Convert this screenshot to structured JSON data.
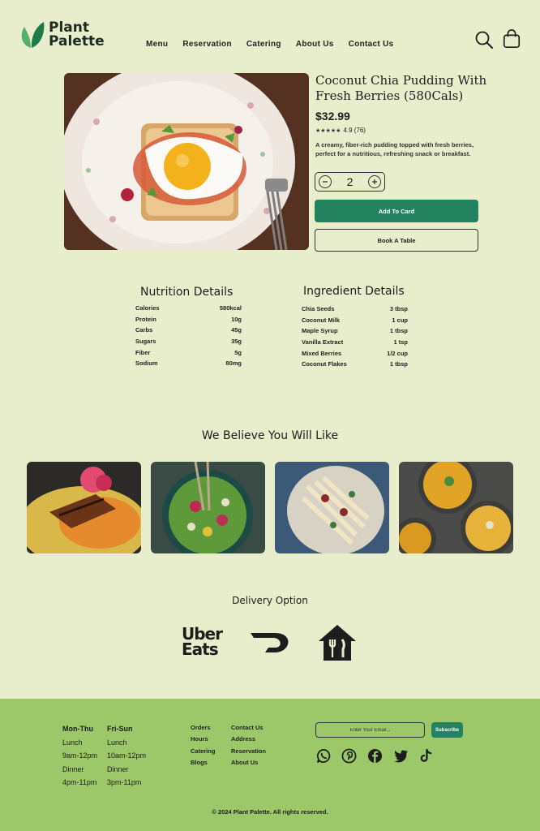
{
  "brand": {
    "line1": "Plant",
    "line2": "Palette",
    "accent": "#23825f",
    "leaf_dark": "#1f7a4a",
    "leaf_light": "#56b06a"
  },
  "nav": {
    "items": [
      "Menu",
      "Reservation",
      "Catering",
      "About Us",
      "Contact Us"
    ]
  },
  "header_icons": [
    "search-icon",
    "shopping-bag-icon"
  ],
  "product": {
    "title": "Coconut Chia Pudding With Fresh Berries (580Cals)",
    "price": "$32.99",
    "stars": "★★★★★",
    "rating": "4.9 (76)",
    "description": "A creamy, fiber-rich pudding topped with fresh berries, perfect for a nutritious, refreshing snack or breakfast.",
    "quantity": "2",
    "add_button": "Add To Card",
    "book_button": "Book A Table"
  },
  "nutrition": {
    "title": "Nutrition Details",
    "rows": [
      [
        "Calories",
        "580kcal"
      ],
      [
        "Protein",
        "10g"
      ],
      [
        "Carbs",
        "45g"
      ],
      [
        "Sugars",
        "35g"
      ],
      [
        "Fiber",
        "5g"
      ],
      [
        "Sodium",
        "80mg"
      ]
    ]
  },
  "ingredients": {
    "title": "Ingredient Details",
    "rows": [
      [
        "Chia Seeds",
        "3 tbsp"
      ],
      [
        "Coconut Milk",
        "1 cup"
      ],
      [
        "Maple Syrup",
        "1 tbsp"
      ],
      [
        "Vanilla Extract",
        "1 tsp"
      ],
      [
        "Mixed Berries",
        "1/2 cup"
      ],
      [
        "Coconut Flakes",
        "1 tbsp"
      ]
    ]
  },
  "recommendations": {
    "title": "We Believe You Will Like"
  },
  "delivery": {
    "title": "Delivery Option",
    "uber_line1": "Uber",
    "uber_line2": "Eats",
    "providers": [
      "uber-eats-logo",
      "doordash-logo",
      "just-eat-logo"
    ]
  },
  "footer": {
    "hours": {
      "col1": [
        "Mon-Thu",
        "Lunch",
        "9am-12pm",
        "Dinner",
        "4pm-11pm"
      ],
      "col2": [
        "Fri-Sun",
        "Lunch",
        "10am-12pm",
        "Dinner",
        "3pm-11pm"
      ]
    },
    "links1": [
      "Orders",
      "Hours",
      "Catering",
      "Blogs"
    ],
    "links2": [
      "Contact Us",
      "Address",
      "Reservation",
      "About Us"
    ],
    "email_placeholder": "Enter Your Email...",
    "subscribe": "Subscribe",
    "social": [
      "whatsapp-icon",
      "pinterest-icon",
      "facebook-icon",
      "twitter-icon",
      "tiktok-icon"
    ],
    "copyright": "© 2024 Plant Palette. All rights reserved."
  }
}
